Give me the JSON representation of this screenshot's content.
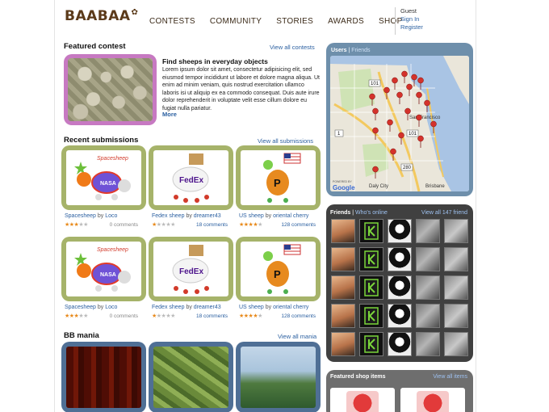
{
  "logo": "BAABAA",
  "nav": [
    "CONTESTS",
    "COMMUNITY",
    "STORIES",
    "AWARDS",
    "SHOP"
  ],
  "user": {
    "status": "Guest",
    "sign_in": "Sign In",
    "register": "Register"
  },
  "featured": {
    "heading": "Featured contest",
    "view_all": "View all contests",
    "title": "Find sheeps in everyday objects",
    "description": "Lorem ipsum dolor sit amet, consectetur adipisicing elit, sed eiusmod tempor incididunt ut labore et dolore magna aliqua. Ut enim ad minim veniam, quis nostrud exercitation ullamco laboris isi ut aliquip ex ea commodo consequat. Duis aute irure dolor reprehenderit in voluptate velit esse cillum dolore eu fugiat nulla pariatur.",
    "more": "More"
  },
  "recent": {
    "heading": "Recent submissions",
    "view_all": "View all submissions",
    "items": [
      {
        "title": "Spacesheep",
        "by": "by",
        "author": "Loco",
        "comments": "0 comments",
        "stars": 3
      },
      {
        "title": "Fedex sheep",
        "by": "by",
        "author": "dreamer43",
        "comments": "18 comments",
        "stars": 1
      },
      {
        "title": "US sheep",
        "by": "by",
        "author": "oriental cherry",
        "comments": "128 comments",
        "stars": 4
      },
      {
        "title": "Spacesheep",
        "by": "by",
        "author": "Loco",
        "comments": "0 comments",
        "stars": 3
      },
      {
        "title": "Fedex sheep",
        "by": "by",
        "author": "dreamer43",
        "comments": "18 comments",
        "stars": 1
      },
      {
        "title": "US sheep",
        "by": "by",
        "author": "oriental cherry",
        "comments": "128 comments",
        "stars": 4
      }
    ],
    "art_text": {
      "spacesheep": "Spacesheep",
      "nasa": "NASA",
      "fedex": "FedEx",
      "usp": "P"
    }
  },
  "mania": {
    "heading": "BB mania",
    "view_all": "View all mania"
  },
  "map": {
    "tab_users": "Users",
    "sep": "|",
    "tab_friends": "Friends",
    "labels": {
      "r101": "101",
      "r101b": "101",
      "r1": "1",
      "r280": "280",
      "daly": "Daly City",
      "brisbane": "Brisbane",
      "sf": "San Francisco",
      "powered": "POWERED BY",
      "google": "Google"
    }
  },
  "friends": {
    "tab_friends": "Friends",
    "sep": "|",
    "tab_online": "Who's online",
    "view_all": "View all 147 friend"
  },
  "shop": {
    "heading": "Featured shop items",
    "view_all": "View all items"
  },
  "colors": {
    "featured_frame": "#c779c2",
    "submission_frame": "#a6b36a",
    "mania_frame": "#4f6f95",
    "map_frame": "#6e8fab",
    "friends_frame": "#404040",
    "link": "#2a5fa0",
    "star": "#e88a1c"
  }
}
